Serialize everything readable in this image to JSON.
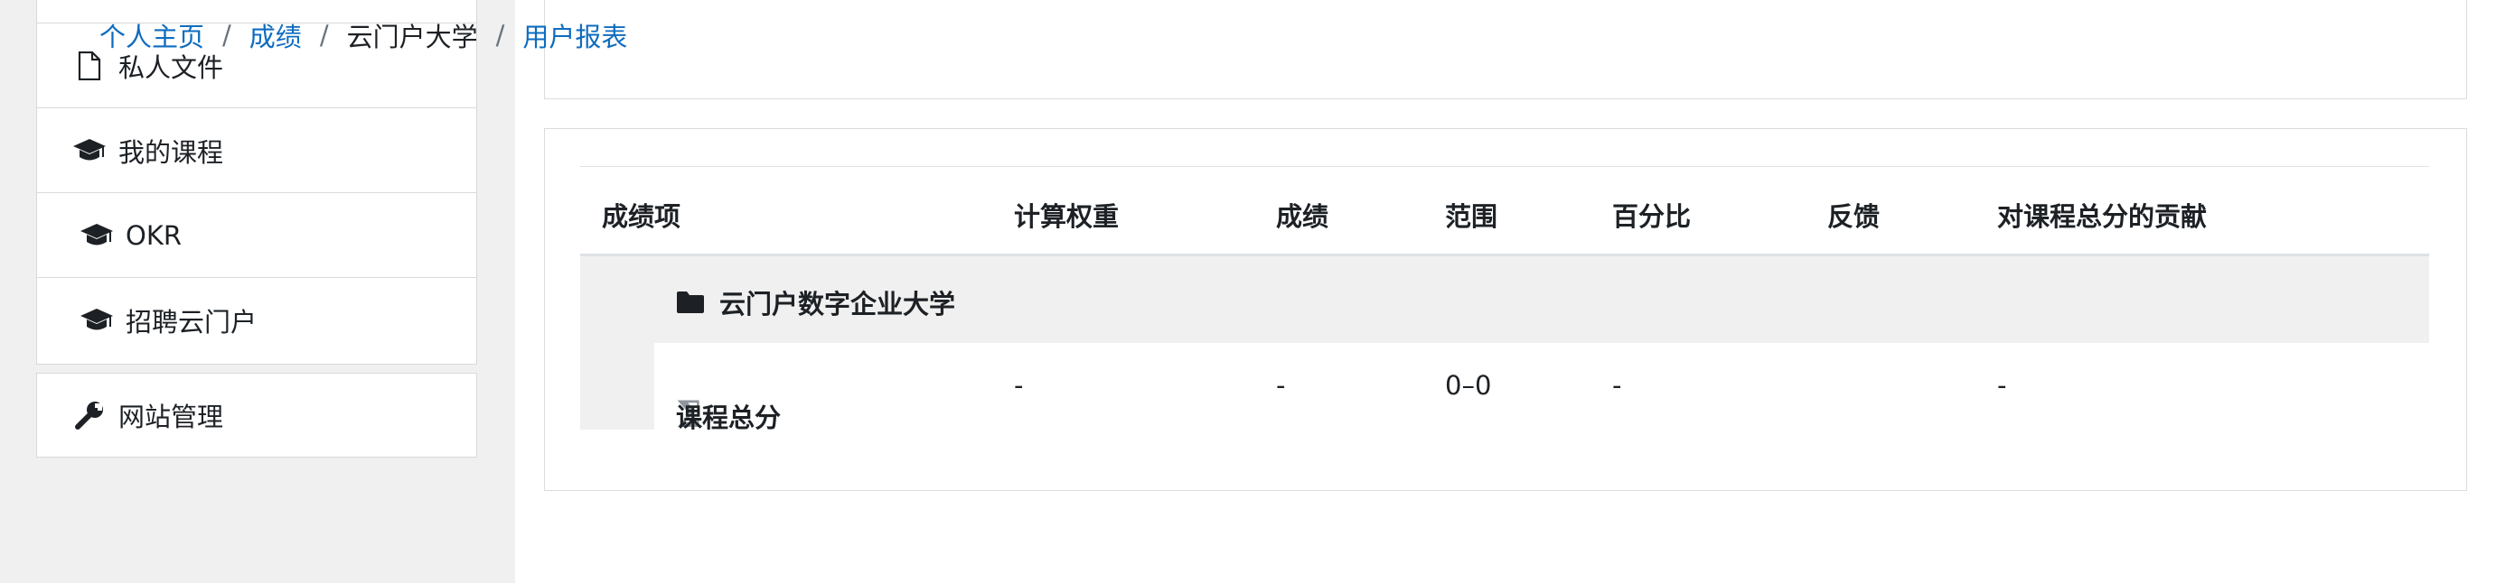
{
  "sidebar": {
    "items": [
      {
        "label": "私人文件",
        "icon": "file-icon"
      },
      {
        "label": "我的课程",
        "icon": "graduation-cap-icon"
      },
      {
        "label": "OKR",
        "icon": "graduation-cap-icon"
      },
      {
        "label": "招聘云门户",
        "icon": "graduation-cap-icon"
      }
    ],
    "admin": {
      "label": "网站管理",
      "icon": "wrench-icon"
    }
  },
  "breadcrumb": {
    "home": "个人主页",
    "grades": "成绩",
    "course": "云门户大学",
    "report": "用户报表",
    "separator": "/"
  },
  "grade_table": {
    "headers": {
      "item": "成绩项",
      "weight": "计算权重",
      "grade": "成绩",
      "range": "范围",
      "percentage": "百分比",
      "feedback": "反馈",
      "contribution": "对课程总分的贡献"
    },
    "category": {
      "label": "云门户数字企业大学",
      "icon": "folder-icon"
    },
    "total_row": {
      "label": "课程总分",
      "icon": "sigma-icon",
      "weight": "-",
      "grade": "-",
      "range": "0–0",
      "percentage": "-",
      "contribution": "-"
    }
  },
  "colors": {
    "link": "#0f6cbf",
    "text": "#1d2125",
    "sidebar_bg": "#f0f0f0",
    "row_bg": "#f0f0f0"
  }
}
